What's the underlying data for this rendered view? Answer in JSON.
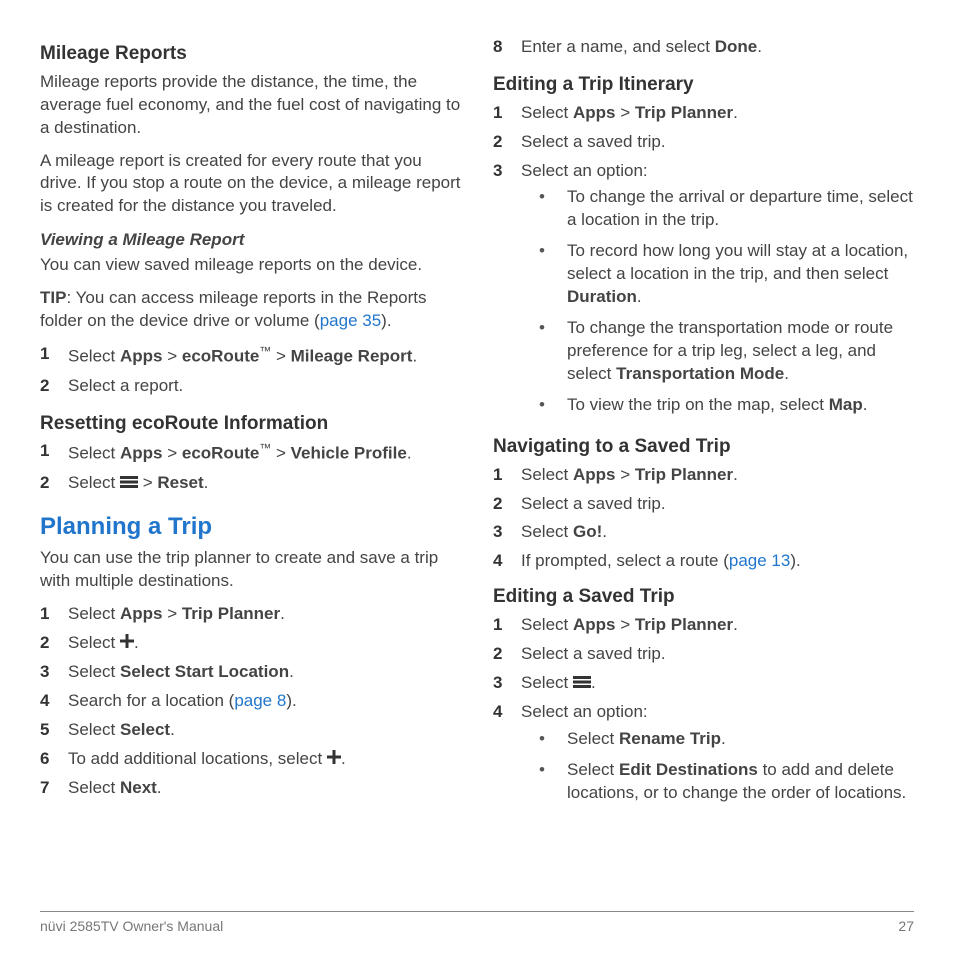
{
  "left": {
    "mileage_h": "Mileage Reports",
    "mileage_p1": "Mileage reports provide the distance, the time, the average fuel economy, and the fuel cost of navigating to a destination.",
    "mileage_p2": "A mileage report is created for every route that you drive. If you stop a route on the device, a mileage report is created for the distance you traveled.",
    "viewing_h": "Viewing a Mileage Report",
    "viewing_p1": "You can view saved mileage reports on the device.",
    "tip_label": "TIP",
    "tip_body": ": You can access mileage reports in the Reports folder on the device drive or volume (",
    "tip_link": "page 35",
    "tip_end": ").",
    "view_steps": {
      "s1a": "Select ",
      "s1_apps": "Apps",
      "s1_gt": " > ",
      "s1_eco": "ecoRoute",
      "s1_gt2": " > ",
      "s1_mr": "Mileage Report",
      "s1_end": ".",
      "s2": "Select a report."
    },
    "reset_h": "Resetting ecoRoute Information",
    "reset_steps": {
      "s1a": "Select ",
      "s1_apps": "Apps",
      "s1_gt": " > ",
      "s1_eco": "ecoRoute",
      "s1_gt2": " > ",
      "s1_vp": "Vehicle Profile",
      "s1_end": ".",
      "s2a": "Select ",
      "s2_gt": " > ",
      "s2_reset": "Reset",
      "s2_end": "."
    },
    "plan_h": "Planning a Trip",
    "plan_p": "You can use the trip planner to create and save a trip with multiple destinations.",
    "plan_steps": {
      "s1a": "Select ",
      "s1_apps": "Apps",
      "s1_gt": " > ",
      "s1_tp": "Trip Planner",
      "s1_end": ".",
      "s2a": "Select ",
      "s2_end": ".",
      "s3a": "Select ",
      "s3_ssl": "Select Start Location",
      "s3_end": ".",
      "s4a": "Search for a location (",
      "s4_link": "page 8",
      "s4_end": ").",
      "s5a": "Select ",
      "s5_sel": "Select",
      "s5_end": ".",
      "s6a": "To add additional locations, select ",
      "s6_end": ".",
      "s7a": "Select ",
      "s7_next": "Next",
      "s7_end": "."
    }
  },
  "right": {
    "s8a": "Enter a name, and select ",
    "s8_done": "Done",
    "s8_end": ".",
    "edit_itin_h": "Editing a Trip Itinerary",
    "edit_itin": {
      "s1a": "Select ",
      "apps": "Apps",
      "gt": " > ",
      "tp": "Trip Planner",
      "end": ".",
      "s2": "Select a saved trip.",
      "s3": "Select an option:",
      "b1": "To change the arrival or departure time, select a location in the trip.",
      "b2a": "To record how long you will stay at a location, select a location in the trip, and then select ",
      "b2_dur": "Duration",
      "b2_end": ".",
      "b3a": "To change the transportation mode or route preference for a trip leg, select a leg, and select ",
      "b3_tm": "Transportation Mode",
      "b3_end": ".",
      "b4a": "To view the trip on the map, select ",
      "b4_map": "Map",
      "b4_end": "."
    },
    "nav_h": "Navigating to a Saved Trip",
    "nav": {
      "s1a": "Select ",
      "apps": "Apps",
      "gt": " > ",
      "tp": "Trip Planner",
      "end": ".",
      "s2": "Select a saved trip.",
      "s3a": "Select ",
      "go": "Go!",
      "s3_end": ".",
      "s4a": "If prompted, select a route (",
      "s4_link": "page 13",
      "s4_end": ")."
    },
    "editsaved_h": "Editing a Saved Trip",
    "editsaved": {
      "s1a": "Select ",
      "apps": "Apps",
      "gt": " > ",
      "tp": "Trip Planner",
      "end": ".",
      "s2": "Select a saved trip.",
      "s3a": "Select ",
      "s3_end": ".",
      "s4": "Select an option:",
      "b1a": "Select ",
      "b1_rt": "Rename Trip",
      "b1_end": ".",
      "b2a": "Select ",
      "b2_ed": "Edit Destinations",
      "b2b": " to add and delete locations, or to change the order of locations."
    }
  },
  "footer": {
    "left": "nüvi 2585TV Owner's Manual",
    "right": "27"
  },
  "nums": {
    "n1": "1",
    "n2": "2",
    "n3": "3",
    "n4": "4",
    "n5": "5",
    "n6": "6",
    "n7": "7",
    "n8": "8"
  },
  "dot": "•",
  "tm": "™"
}
